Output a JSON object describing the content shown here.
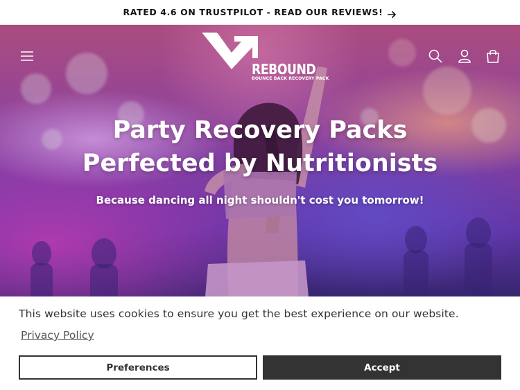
{
  "announcement": {
    "text": "RATED 4.6 ON TRUSTPILOT - READ OUR REVIEWS!",
    "icon": "arrow-right-icon"
  },
  "header": {
    "logo_word": "REBOUND",
    "logo_tagline": "BOUNCE BACK RECOVERY PACK",
    "icons": [
      "menu-icon",
      "search-icon",
      "account-icon",
      "cart-icon"
    ]
  },
  "hero": {
    "heading_line1": "Party Recovery Packs",
    "heading_line2": "Perfected by Nutritionists",
    "subheading": "Because dancing all night shouldn't cost you tomorrow!"
  },
  "cookie_banner": {
    "message": "This website uses cookies to ensure you get the best experience on our website.",
    "privacy_link": "Privacy Policy",
    "preferences_label": "Preferences",
    "accept_label": "Accept"
  },
  "colors": {
    "text_dark": "#121212",
    "button_dark": "#333333",
    "hero_accent": "#a34fb4"
  }
}
